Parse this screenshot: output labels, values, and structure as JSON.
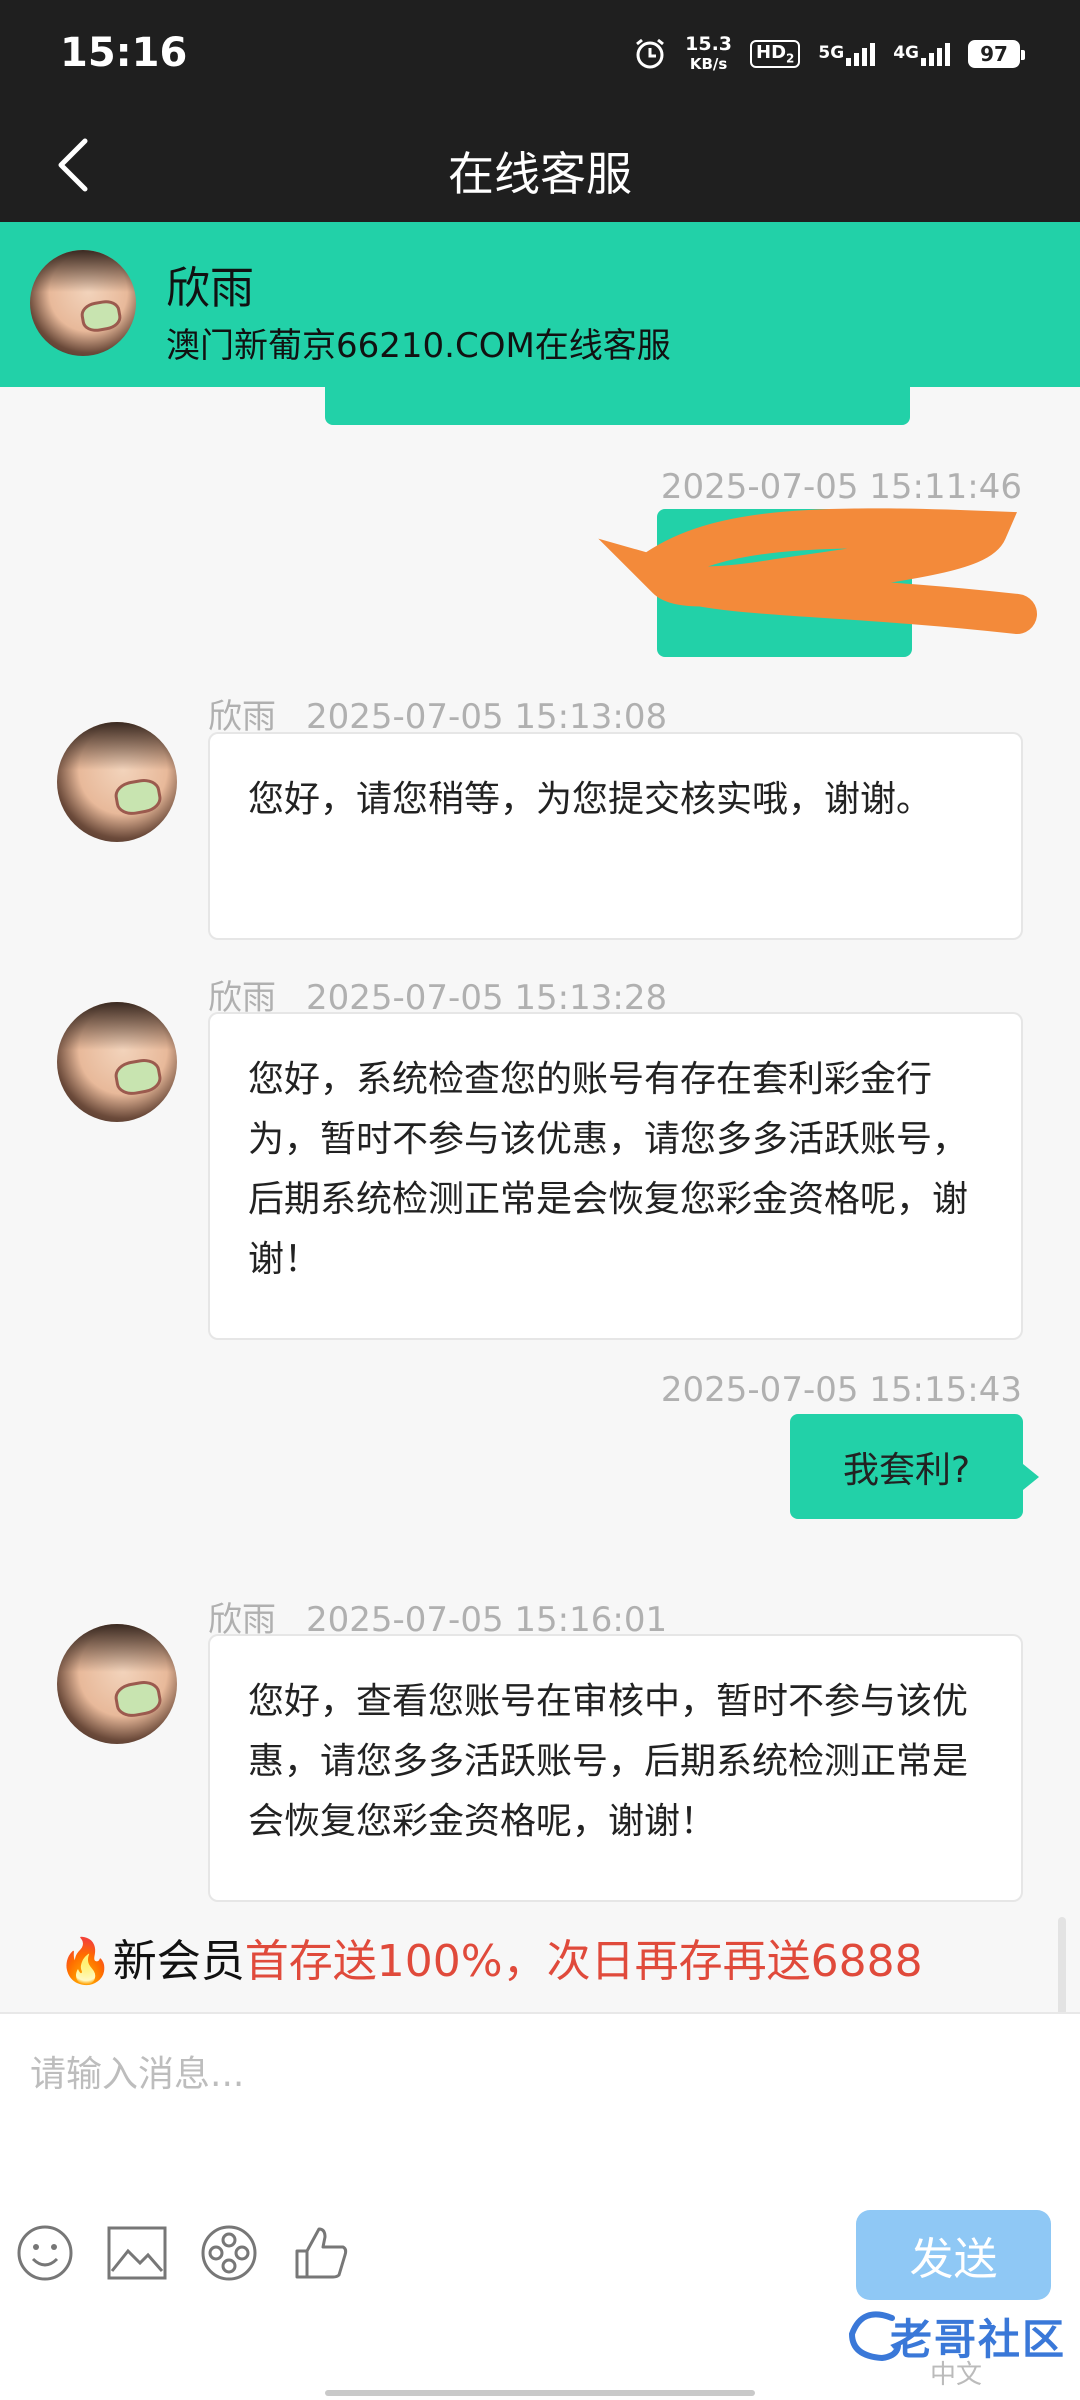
{
  "status_bar": {
    "time": "15:16",
    "net_speed_value": "15.3",
    "net_speed_unit": "KB/s",
    "hd_label": "HD",
    "sim_sub": "2",
    "signal_5g": "5G",
    "signal_4g": "4G",
    "battery": "97"
  },
  "titlebar": {
    "title": "在线客服"
  },
  "agent": {
    "name": "欣雨",
    "subtitle": "澳门新葡京66210.COM在线客服"
  },
  "messages": [
    {
      "side": "out",
      "timestamp": "2025-07-05 15:11:46",
      "text": ""
    },
    {
      "side": "in",
      "sender": "欣雨",
      "timestamp": "2025-07-05 15:13:08",
      "text": "您好，请您稍等，为您提交核实哦，谢谢。"
    },
    {
      "side": "in",
      "sender": "欣雨",
      "timestamp": "2025-07-05 15:13:28",
      "text": "您好，系统检查您的账号有存在套利彩金行为，暂时不参与该优惠，请您多多活跃账号，后期系统检测正常是会恢复您彩金资格呢，谢谢！"
    },
    {
      "side": "out",
      "timestamp": "2025-07-05 15:15:43",
      "text": "我套利?"
    },
    {
      "side": "in",
      "sender": "欣雨",
      "timestamp": "2025-07-05 15:16:01",
      "text": "您好，查看您账号在审核中，暂时不参与该优惠，请您多多活跃账号，后期系统检测正常是会恢复您彩金资格呢，谢谢！"
    }
  ],
  "promo": {
    "prefix": "新会员",
    "text": "首存送100%，次日再存再送6888"
  },
  "input": {
    "placeholder": "请输入消息...",
    "send_label": "发送"
  },
  "icons": [
    "emoji-icon",
    "image-icon",
    "video-icon",
    "thumbs-up-icon"
  ],
  "colors": {
    "accent": "#22d1a8",
    "send": "#8fc8f5",
    "promo_red": "#e04a3b"
  },
  "ime_label": "中文",
  "watermark": "老哥社区"
}
